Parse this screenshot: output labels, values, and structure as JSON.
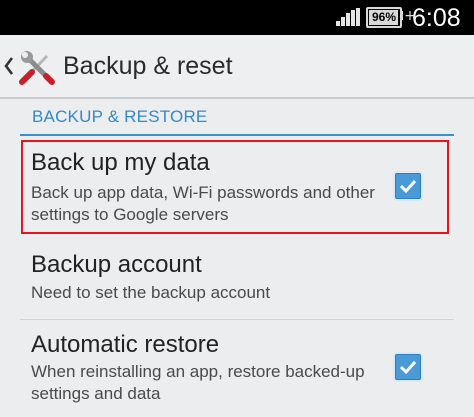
{
  "status_bar": {
    "battery_percent": "96%",
    "battery_level": 0.96,
    "time": "6:08",
    "icons": [
      "signal-icon",
      "battery-icon",
      "charging-plus-icon"
    ]
  },
  "action_bar": {
    "title": "Backup & reset",
    "icons": [
      "back-chevron-icon",
      "settings-tools-icon"
    ]
  },
  "section": {
    "header": "BACKUP & RESTORE"
  },
  "preferences": [
    {
      "title": "Back up my data",
      "summary": "Back up app data, Wi-Fi passwords and other settings to Google servers",
      "checked": true,
      "highlighted": true
    },
    {
      "title": "Backup account",
      "summary": "Need to set the backup account"
    },
    {
      "title": "Automatic restore",
      "summary": "When reinstalling an app, restore backed-up settings and data",
      "checked": true
    }
  ],
  "colors": {
    "accent": "#3389c9",
    "checkbox": "#4a9ad8",
    "highlight_border": "#e8141b",
    "background": "#ecedee"
  }
}
